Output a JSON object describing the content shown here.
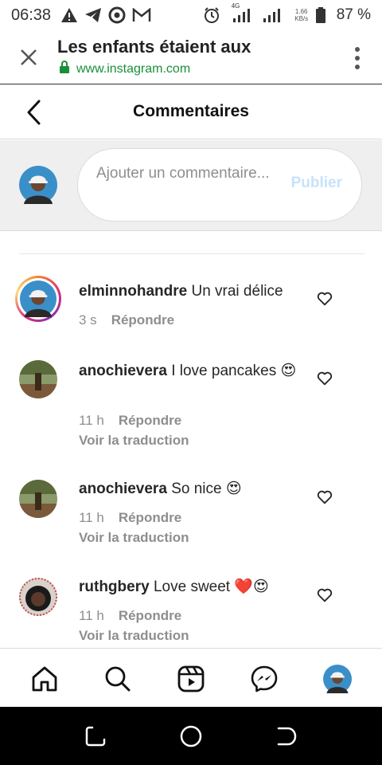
{
  "status_bar": {
    "time": "06:38",
    "network_type": "4G",
    "net_speed_value": "1.66",
    "net_speed_unit": "KB/s",
    "battery": "87 %"
  },
  "browser": {
    "title": "Les enfants étaient aux",
    "url": "www.instagram.com",
    "url_color": "#1a8f3b"
  },
  "header": {
    "title": "Commentaires"
  },
  "composer": {
    "placeholder": "Ajouter un commentaire...",
    "publish_label": "Publier",
    "publish_color": "#c7e2fb"
  },
  "comments": [
    {
      "user": "elminnohandre",
      "text": "Un vrai délice",
      "time": "3 s",
      "reply": "Répondre",
      "translate": "",
      "has_story": true
    },
    {
      "user": "anochievera",
      "text": "I love pancakes 😍",
      "time": "11 h",
      "reply": "Répondre",
      "translate": "Voir la traduction",
      "has_story": false
    },
    {
      "user": "anochievera",
      "text": "So nice 😍",
      "time": "11 h",
      "reply": "Répondre",
      "translate": "Voir la traduction",
      "has_story": false
    },
    {
      "user": "ruthgbery",
      "text": "Love sweet ❤️😍",
      "time": "11 h",
      "reply": "Répondre",
      "translate": "Voir la traduction",
      "has_story": false
    }
  ],
  "bottom_nav": {
    "items": [
      "home-icon",
      "search-icon",
      "reels-icon",
      "messenger-icon",
      "profile-avatar"
    ]
  },
  "android_nav": {
    "items": [
      "recents-icon",
      "home-circle-icon",
      "back-icon"
    ]
  }
}
